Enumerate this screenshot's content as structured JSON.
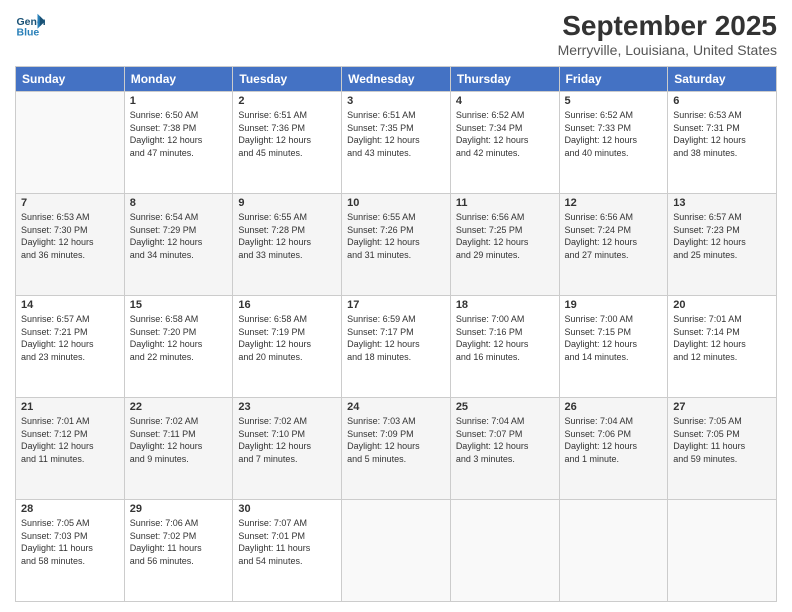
{
  "logo": {
    "line1": "General",
    "line2": "Blue"
  },
  "title": "September 2025",
  "subtitle": "Merryville, Louisiana, United States",
  "days_of_week": [
    "Sunday",
    "Monday",
    "Tuesday",
    "Wednesday",
    "Thursday",
    "Friday",
    "Saturday"
  ],
  "weeks": [
    [
      {
        "day": "",
        "info": ""
      },
      {
        "day": "1",
        "info": "Sunrise: 6:50 AM\nSunset: 7:38 PM\nDaylight: 12 hours\nand 47 minutes."
      },
      {
        "day": "2",
        "info": "Sunrise: 6:51 AM\nSunset: 7:36 PM\nDaylight: 12 hours\nand 45 minutes."
      },
      {
        "day": "3",
        "info": "Sunrise: 6:51 AM\nSunset: 7:35 PM\nDaylight: 12 hours\nand 43 minutes."
      },
      {
        "day": "4",
        "info": "Sunrise: 6:52 AM\nSunset: 7:34 PM\nDaylight: 12 hours\nand 42 minutes."
      },
      {
        "day": "5",
        "info": "Sunrise: 6:52 AM\nSunset: 7:33 PM\nDaylight: 12 hours\nand 40 minutes."
      },
      {
        "day": "6",
        "info": "Sunrise: 6:53 AM\nSunset: 7:31 PM\nDaylight: 12 hours\nand 38 minutes."
      }
    ],
    [
      {
        "day": "7",
        "info": "Sunrise: 6:53 AM\nSunset: 7:30 PM\nDaylight: 12 hours\nand 36 minutes."
      },
      {
        "day": "8",
        "info": "Sunrise: 6:54 AM\nSunset: 7:29 PM\nDaylight: 12 hours\nand 34 minutes."
      },
      {
        "day": "9",
        "info": "Sunrise: 6:55 AM\nSunset: 7:28 PM\nDaylight: 12 hours\nand 33 minutes."
      },
      {
        "day": "10",
        "info": "Sunrise: 6:55 AM\nSunset: 7:26 PM\nDaylight: 12 hours\nand 31 minutes."
      },
      {
        "day": "11",
        "info": "Sunrise: 6:56 AM\nSunset: 7:25 PM\nDaylight: 12 hours\nand 29 minutes."
      },
      {
        "day": "12",
        "info": "Sunrise: 6:56 AM\nSunset: 7:24 PM\nDaylight: 12 hours\nand 27 minutes."
      },
      {
        "day": "13",
        "info": "Sunrise: 6:57 AM\nSunset: 7:23 PM\nDaylight: 12 hours\nand 25 minutes."
      }
    ],
    [
      {
        "day": "14",
        "info": "Sunrise: 6:57 AM\nSunset: 7:21 PM\nDaylight: 12 hours\nand 23 minutes."
      },
      {
        "day": "15",
        "info": "Sunrise: 6:58 AM\nSunset: 7:20 PM\nDaylight: 12 hours\nand 22 minutes."
      },
      {
        "day": "16",
        "info": "Sunrise: 6:58 AM\nSunset: 7:19 PM\nDaylight: 12 hours\nand 20 minutes."
      },
      {
        "day": "17",
        "info": "Sunrise: 6:59 AM\nSunset: 7:17 PM\nDaylight: 12 hours\nand 18 minutes."
      },
      {
        "day": "18",
        "info": "Sunrise: 7:00 AM\nSunset: 7:16 PM\nDaylight: 12 hours\nand 16 minutes."
      },
      {
        "day": "19",
        "info": "Sunrise: 7:00 AM\nSunset: 7:15 PM\nDaylight: 12 hours\nand 14 minutes."
      },
      {
        "day": "20",
        "info": "Sunrise: 7:01 AM\nSunset: 7:14 PM\nDaylight: 12 hours\nand 12 minutes."
      }
    ],
    [
      {
        "day": "21",
        "info": "Sunrise: 7:01 AM\nSunset: 7:12 PM\nDaylight: 12 hours\nand 11 minutes."
      },
      {
        "day": "22",
        "info": "Sunrise: 7:02 AM\nSunset: 7:11 PM\nDaylight: 12 hours\nand 9 minutes."
      },
      {
        "day": "23",
        "info": "Sunrise: 7:02 AM\nSunset: 7:10 PM\nDaylight: 12 hours\nand 7 minutes."
      },
      {
        "day": "24",
        "info": "Sunrise: 7:03 AM\nSunset: 7:09 PM\nDaylight: 12 hours\nand 5 minutes."
      },
      {
        "day": "25",
        "info": "Sunrise: 7:04 AM\nSunset: 7:07 PM\nDaylight: 12 hours\nand 3 minutes."
      },
      {
        "day": "26",
        "info": "Sunrise: 7:04 AM\nSunset: 7:06 PM\nDaylight: 12 hours\nand 1 minute."
      },
      {
        "day": "27",
        "info": "Sunrise: 7:05 AM\nSunset: 7:05 PM\nDaylight: 11 hours\nand 59 minutes."
      }
    ],
    [
      {
        "day": "28",
        "info": "Sunrise: 7:05 AM\nSunset: 7:03 PM\nDaylight: 11 hours\nand 58 minutes."
      },
      {
        "day": "29",
        "info": "Sunrise: 7:06 AM\nSunset: 7:02 PM\nDaylight: 11 hours\nand 56 minutes."
      },
      {
        "day": "30",
        "info": "Sunrise: 7:07 AM\nSunset: 7:01 PM\nDaylight: 11 hours\nand 54 minutes."
      },
      {
        "day": "",
        "info": ""
      },
      {
        "day": "",
        "info": ""
      },
      {
        "day": "",
        "info": ""
      },
      {
        "day": "",
        "info": ""
      }
    ]
  ]
}
